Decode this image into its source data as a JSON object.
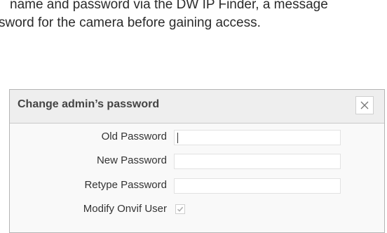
{
  "intro": {
    "line1": "name and password via the DW IP Finder, a message",
    "line2": "sword for the camera before gaining access."
  },
  "dialog": {
    "title": "Change admin’s password",
    "fields": {
      "old_password": {
        "label": "Old Password",
        "value": ""
      },
      "new_password": {
        "label": "New Password",
        "value": ""
      },
      "retype_password": {
        "label": "Retype Password",
        "value": ""
      }
    },
    "modify_onvif": {
      "label": "Modify Onvif User",
      "checked": true
    }
  },
  "colors": {
    "check": "#b0b0b0"
  },
  "icons": {
    "close": "close-icon",
    "check": "check-icon"
  }
}
